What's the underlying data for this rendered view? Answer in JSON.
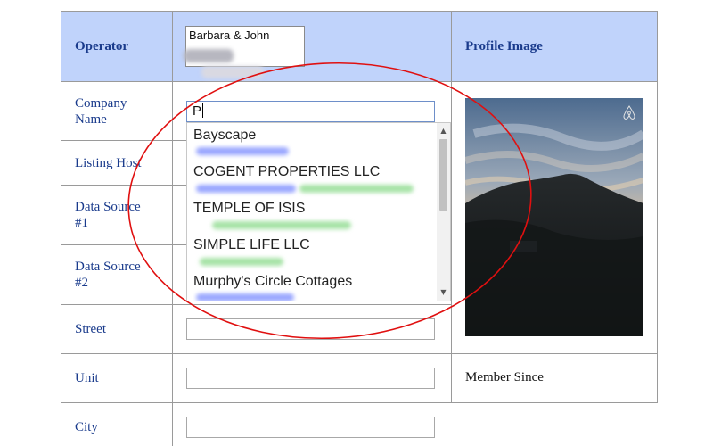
{
  "table": {
    "labels": {
      "operator": "Operator",
      "company_name": "Company\nName",
      "listing_host": "Listing Host",
      "data_source_1": "Data Source\n#1",
      "data_source_2": "Data Source\n#2",
      "street": "Street",
      "unit": "Unit",
      "city": "City",
      "profile_image": "Profile Image",
      "member_since": "Member Since"
    },
    "operator_value": "Barbara & John",
    "company_input_value": "P"
  },
  "autocomplete": {
    "items": [
      "Bayscape",
      "COGENT PROPERTIES LLC",
      "TEMPLE OF ISIS",
      "SIMPLE LIFE LLC",
      "Murphy's Circle Cottages"
    ]
  },
  "icons": {
    "logo": "airbnb-logo-icon",
    "scroll_up": "chevron-up-icon",
    "scroll_down": "chevron-down-icon"
  },
  "colors": {
    "header_bg": "#c0d3fb",
    "label_text": "#1a3b8c",
    "annotation_circle": "#e01010"
  }
}
